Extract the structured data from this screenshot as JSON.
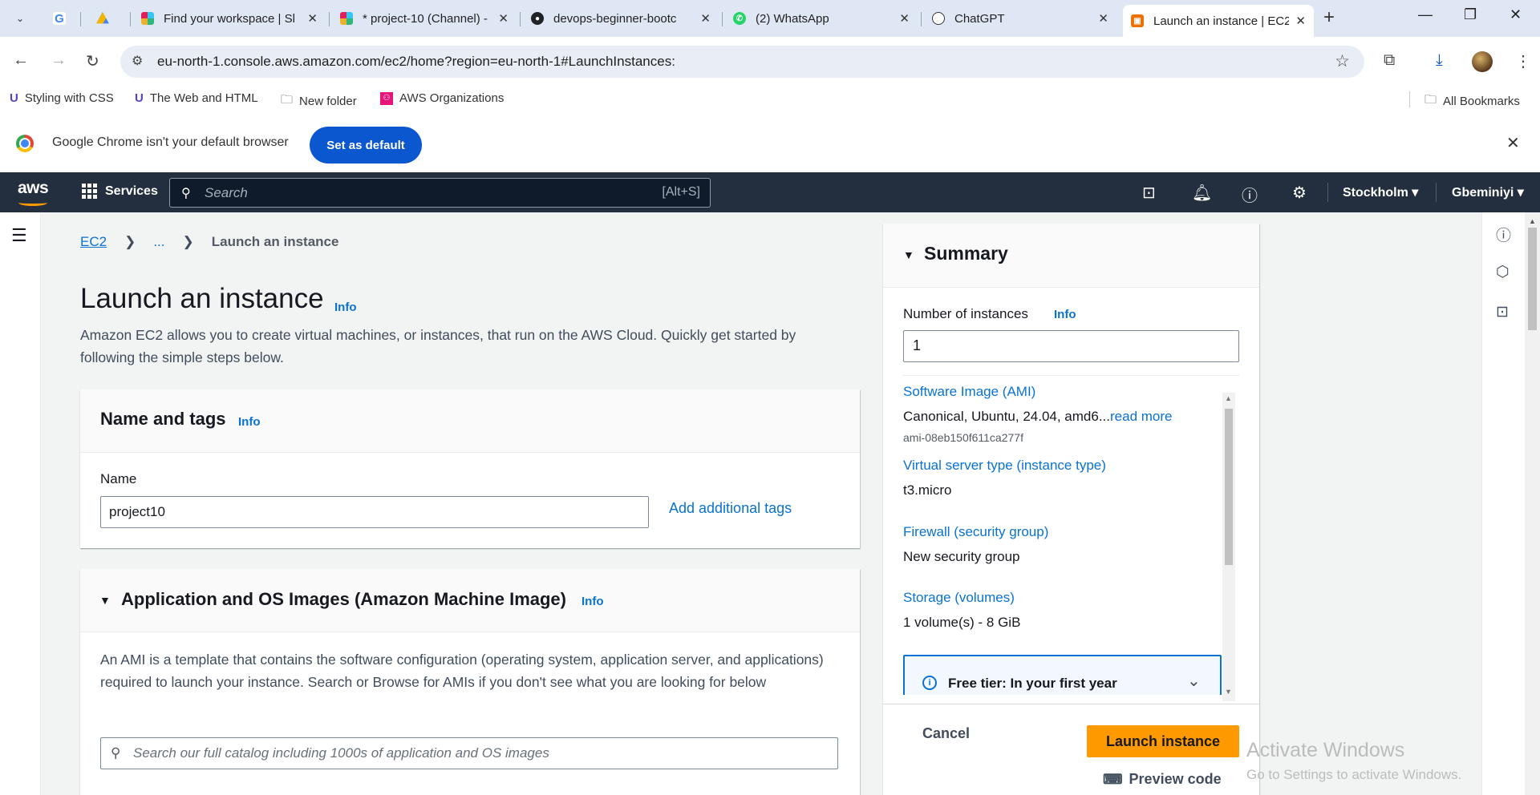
{
  "browser": {
    "tabs": [
      {
        "title": "",
        "icon": "google-icon"
      },
      {
        "title": "",
        "icon": "drive-icon"
      },
      {
        "title": "Find your workspace | Sl",
        "icon": "slack-icon"
      },
      {
        "title": "* project-10 (Channel) -",
        "icon": "slack-icon"
      },
      {
        "title": "devops-beginner-bootc",
        "icon": "github-icon"
      },
      {
        "title": "(2) WhatsApp",
        "icon": "whatsapp-icon"
      },
      {
        "title": "ChatGPT",
        "icon": "chatgpt-icon"
      },
      {
        "title": "Launch an instance | EC2",
        "icon": "aws-icon"
      }
    ],
    "url": "eu-north-1.console.aws.amazon.com/ec2/home?region=eu-north-1#LaunchInstances:",
    "bookmarks": [
      {
        "label": "Styling with CSS"
      },
      {
        "label": "The Web and HTML"
      },
      {
        "label": "New folder"
      },
      {
        "label": "AWS Organizations"
      }
    ],
    "all_bookmarks": "All Bookmarks",
    "default_msg": "Google Chrome isn't your default browser",
    "set_default": "Set as default"
  },
  "aws_nav": {
    "logo": "aws",
    "services": "Services",
    "search_placeholder": "Search",
    "search_shortcut": "[Alt+S]",
    "region": "Stockholm",
    "user": "Gbeminiyi",
    "accent": "#ff9900"
  },
  "page": {
    "breadcrumb": {
      "root": "EC2",
      "ellipsis": "...",
      "current": "Launch an instance"
    },
    "title": "Launch an instance",
    "info": "Info",
    "description": "Amazon EC2 allows you to create virtual machines, or instances, that run on the AWS Cloud. Quickly get started by following the simple steps below."
  },
  "name_tags": {
    "heading": "Name and tags",
    "info": "Info",
    "name_label": "Name",
    "name_value": "project10",
    "add_tags": "Add additional tags"
  },
  "ami": {
    "heading": "Application and OS Images (Amazon Machine Image)",
    "info": "Info",
    "description": "An AMI is a template that contains the software configuration (operating system, application server, and applications) required to launch your instance. Search or Browse for AMIs if you don't see what you are looking for below",
    "search_placeholder": "Search our full catalog including 1000s of application and OS images"
  },
  "summary": {
    "heading": "Summary",
    "num_label": "Number of instances",
    "info": "Info",
    "num_value": "1",
    "ami_key": "Software Image (AMI)",
    "ami_value": "Canonical, Ubuntu, 24.04, amd6...",
    "read_more": "read more",
    "ami_id": "ami-08eb150f611ca277f",
    "type_key": "Virtual server type (instance type)",
    "type_value": "t3.micro",
    "fw_key": "Firewall (security group)",
    "fw_value": "New security group",
    "storage_key": "Storage (volumes)",
    "storage_value": "1 volume(s) - 8 GiB",
    "alert": "Free tier: In your first year",
    "cancel": "Cancel",
    "launch": "Launch instance",
    "preview": "Preview code"
  },
  "watermark": {
    "line1": "Activate Windows",
    "line2": "Go to Settings to activate Windows."
  }
}
